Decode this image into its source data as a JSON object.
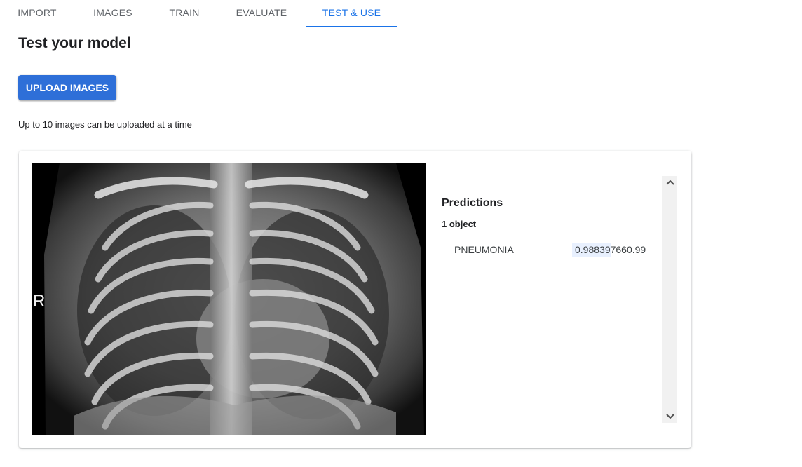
{
  "tabs": [
    {
      "label": "IMPORT",
      "active": false
    },
    {
      "label": "IMAGES",
      "active": false
    },
    {
      "label": "TRAIN",
      "active": false
    },
    {
      "label": "EVALUATE",
      "active": false
    },
    {
      "label": "TEST & USE",
      "active": true
    }
  ],
  "page": {
    "title": "Test your model",
    "upload_label": "UPLOAD IMAGES",
    "hint": "Up to 10 images can be uploaded at a time"
  },
  "image": {
    "marker": "R"
  },
  "predictions": {
    "title": "Predictions",
    "count": "1 object",
    "items": [
      {
        "label": "PNEUMONIA",
        "score": "0.98839766",
        "rounded": "0.99",
        "fraction": 0.49
      }
    ]
  },
  "scrollbar": {
    "up_icon": "chevron-up-icon",
    "down_icon": "chevron-down-icon"
  },
  "colors": {
    "accent": "#1a73e8",
    "button": "#2e6fd8",
    "score_highlight": "#e8f0fe"
  }
}
